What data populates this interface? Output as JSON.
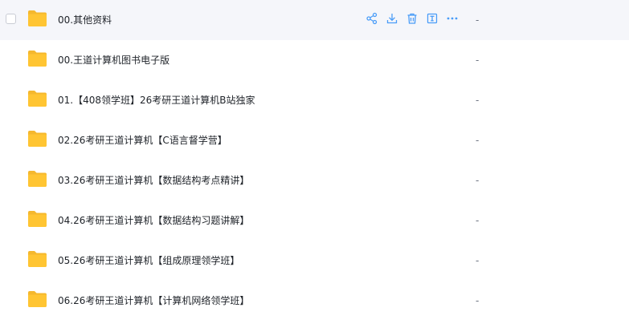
{
  "accent_color": "#4a9df8",
  "folder_color": "#ffc533",
  "rows": [
    {
      "name": "00.其他资料",
      "size": "-"
    },
    {
      "name": "00.王道计算机图书电子版",
      "size": "-"
    },
    {
      "name": "01.【408领学班】26考研王道计算机B站独家",
      "size": "-"
    },
    {
      "name": "02.26考研王道计算机【C语言督学营】",
      "size": "-"
    },
    {
      "name": "03.26考研王道计算机【数据结构考点精讲】",
      "size": "-"
    },
    {
      "name": "04.26考研王道计算机【数据结构习题讲解】",
      "size": "-"
    },
    {
      "name": "05.26考研王道计算机【组成原理领学班】",
      "size": "-"
    },
    {
      "name": "06.26考研王道计算机【计算机网络领学班】",
      "size": "-"
    }
  ],
  "row_actions": [
    "share-icon",
    "download-icon",
    "delete-icon",
    "rename-icon",
    "more-icon"
  ]
}
